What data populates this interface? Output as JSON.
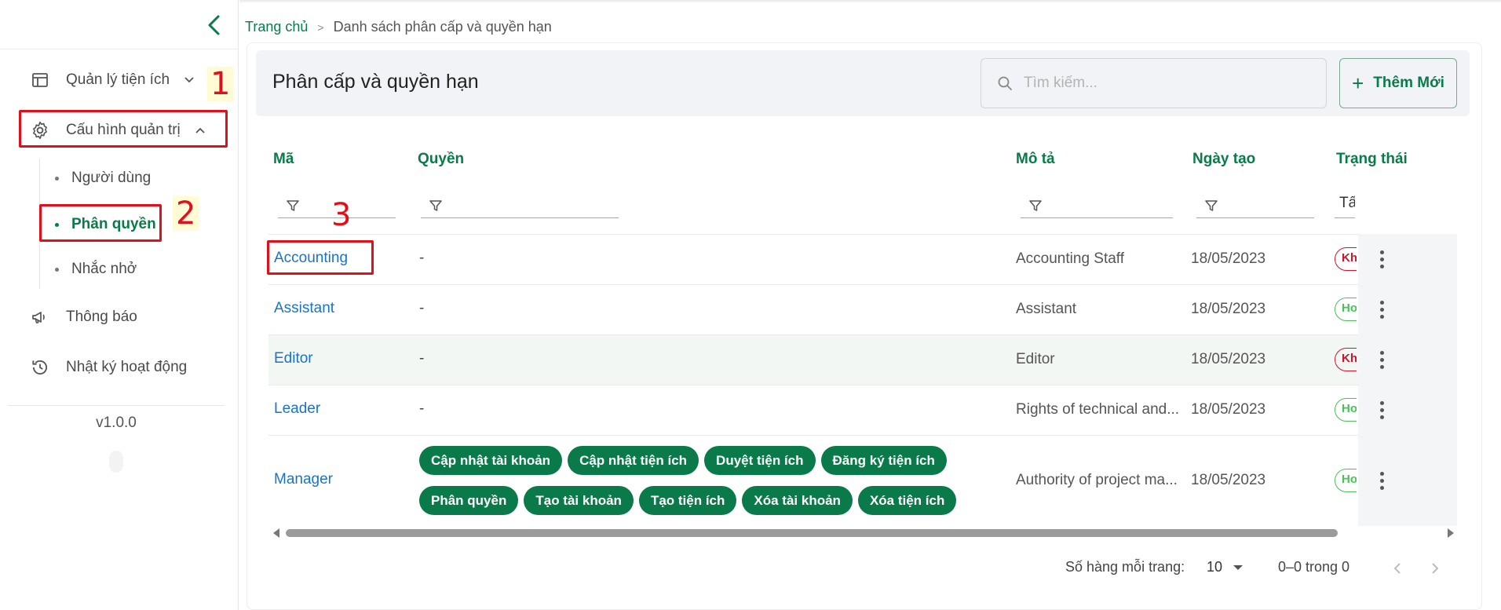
{
  "sidebar": {
    "version": "v1.0.0",
    "items": [
      {
        "label": "Quản lý tiện ích",
        "icon": "layout-icon"
      },
      {
        "label": "Cấu hình quản trị",
        "icon": "gear-icon"
      },
      {
        "label": "Thông báo",
        "icon": "megaphone-icon"
      },
      {
        "label": "Nhật ký hoạt động",
        "icon": "history-icon"
      }
    ],
    "sub_items": [
      "Người dùng",
      "Phân quyền",
      "Nhắc nhở"
    ]
  },
  "annotations": [
    "1",
    "2",
    "3"
  ],
  "breadcrumb": {
    "home": "Trang chủ",
    "separator": ">",
    "current": "Danh sách phân cấp và quyền hạn"
  },
  "page": {
    "title": "Phân cấp và quyền hạn",
    "search_placeholder": "Tìm kiếm...",
    "add_button": "Thêm Mới"
  },
  "table": {
    "columns": [
      "Mã",
      "Quyền",
      "Mô tả",
      "Ngày tạo",
      "Trạng thái"
    ],
    "status_filter_value": "Tất cả",
    "rows": [
      {
        "code": "Accounting",
        "permissions": "-",
        "description": "Accounting Staff",
        "date": "18/05/2023",
        "status": "Khóa",
        "status_type": "inactive"
      },
      {
        "code": "Assistant",
        "permissions": "-",
        "description": "Assistant",
        "date": "18/05/2023",
        "status": "Hoạt động",
        "status_type": "active"
      },
      {
        "code": "Editor",
        "permissions": "-",
        "description": "Editor",
        "date": "18/05/2023",
        "status": "Khóa",
        "status_type": "inactive"
      },
      {
        "code": "Leader",
        "permissions": "-",
        "description": "Rights of technical and...",
        "date": "18/05/2023",
        "status": "Hoạt động",
        "status_type": "active"
      },
      {
        "code": "Manager",
        "permission_chips": [
          "Cập nhật tài khoản",
          "Cập nhật tiện ích",
          "Duyệt tiện ích",
          "Đăng ký tiện ích",
          "Phân quyền",
          "Tạo tài khoản",
          "Tạo tiện ích",
          "Xóa tài khoản",
          "Xóa tiện ích"
        ],
        "description": "Authority of project ma...",
        "date": "18/05/2023",
        "status": "Hoạt động",
        "status_type": "active"
      }
    ]
  },
  "pagination": {
    "rows_per_page_label": "Số hàng mỗi trang:",
    "rows_per_page": "10",
    "range": "0–0 trong 0"
  },
  "colors": {
    "primary": "#0b7a4b",
    "link": "#1a73c7",
    "danger": "#d0142c",
    "success": "#4bbf5a",
    "annotation": "#e0101a"
  }
}
